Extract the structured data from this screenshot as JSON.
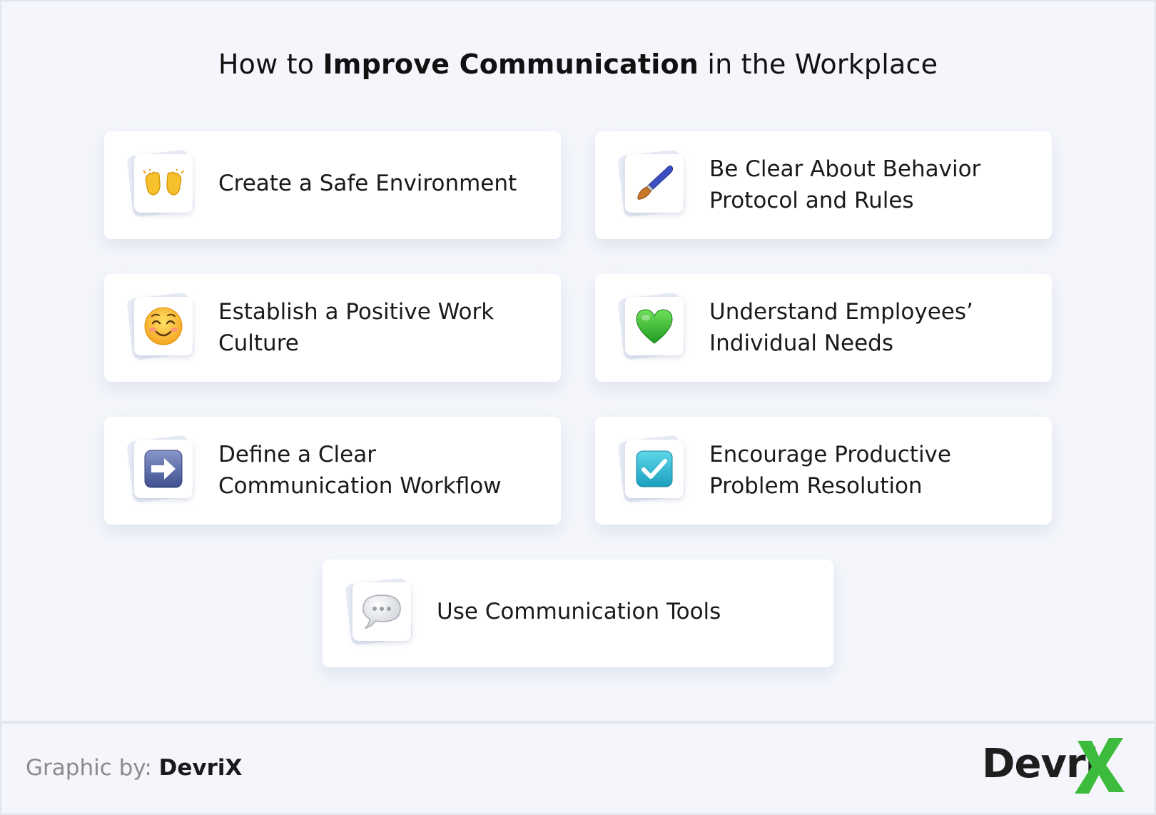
{
  "title": {
    "prefix": "How to ",
    "bold": "Improve Communication",
    "suffix": " in the Workplace"
  },
  "cards": [
    {
      "icon": "raised-hands-icon",
      "line1": "Create a Safe Environment",
      "line2": ""
    },
    {
      "icon": "paintbrush-icon",
      "line1": "Be Clear About Behavior",
      "line2": "Protocol and Rules"
    },
    {
      "icon": "smiling-face-icon",
      "line1": "Establish a Positive Work",
      "line2": "Culture"
    },
    {
      "icon": "green-heart-icon",
      "line1": "Understand Employees’",
      "line2": "Individual Needs"
    },
    {
      "icon": "right-arrow-icon",
      "line1": "Define a Clear",
      "line2": "Communication Workflow"
    },
    {
      "icon": "check-box-icon",
      "line1": "Encourage Productive",
      "line2": "Problem Resolution"
    },
    {
      "icon": "speech-balloon-icon",
      "line1": "Use Communication Tools",
      "line2": ""
    }
  ],
  "footer": {
    "label": "Graphic by: ",
    "brand": "DevriX"
  },
  "logo": {
    "text": "Devri",
    "x_color": "#3dbb3d"
  }
}
